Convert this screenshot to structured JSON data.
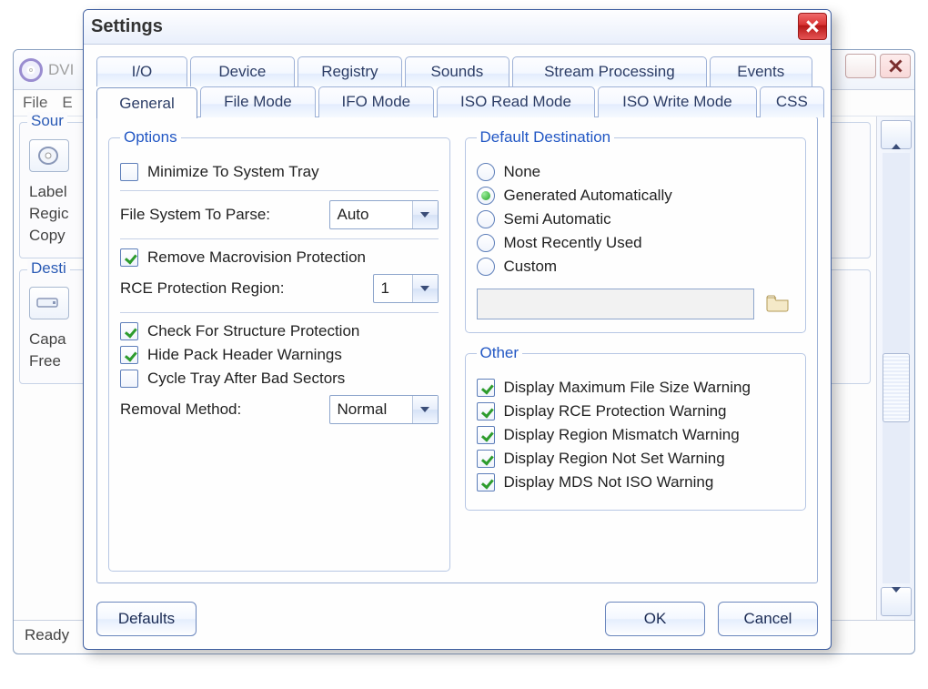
{
  "parent": {
    "title_fragment": "DVI",
    "menu": {
      "file": "File",
      "e": "E"
    },
    "source": {
      "legend": "Sour",
      "label": "Label",
      "regic": "Regic",
      "copy": "Copy"
    },
    "destination": {
      "legend": "Desti",
      "capa": "Capa",
      "free": "Free"
    },
    "status": "Ready"
  },
  "dialog": {
    "title": "Settings",
    "tabs_row1": [
      "I/O",
      "Device",
      "Registry",
      "Sounds",
      "Stream Processing",
      "Events"
    ],
    "tabs_row2": [
      "General",
      "File Mode",
      "IFO Mode",
      "ISO Read Mode",
      "ISO Write Mode",
      "CSS"
    ],
    "active_tab": "General",
    "options": {
      "legend": "Options",
      "minimize_tray": {
        "label": "Minimize To System Tray",
        "checked": false
      },
      "file_system_label": "File System To Parse:",
      "file_system_value": "Auto",
      "remove_macrovision": {
        "label": "Remove Macrovision Protection",
        "checked": true
      },
      "rce_region_label": "RCE Protection Region:",
      "rce_region_value": "1",
      "check_structure": {
        "label": "Check For Structure Protection",
        "checked": true
      },
      "hide_pack_header": {
        "label": "Hide Pack Header Warnings",
        "checked": true
      },
      "cycle_tray": {
        "label": "Cycle Tray After Bad Sectors",
        "checked": false
      },
      "removal_method_label": "Removal Method:",
      "removal_method_value": "Normal"
    },
    "default_destination": {
      "legend": "Default Destination",
      "options": [
        "None",
        "Generated Automatically",
        "Semi Automatic",
        "Most Recently Used",
        "Custom"
      ],
      "selected": "Generated Automatically",
      "custom_path": ""
    },
    "other": {
      "legend": "Other",
      "items": [
        {
          "label": "Display Maximum File Size Warning",
          "checked": true
        },
        {
          "label": "Display RCE Protection Warning",
          "checked": true
        },
        {
          "label": "Display Region Mismatch Warning",
          "checked": true
        },
        {
          "label": "Display Region Not Set Warning",
          "checked": true
        },
        {
          "label": "Display MDS Not ISO Warning",
          "checked": true
        }
      ]
    },
    "buttons": {
      "defaults": "Defaults",
      "ok": "OK",
      "cancel": "Cancel"
    }
  }
}
